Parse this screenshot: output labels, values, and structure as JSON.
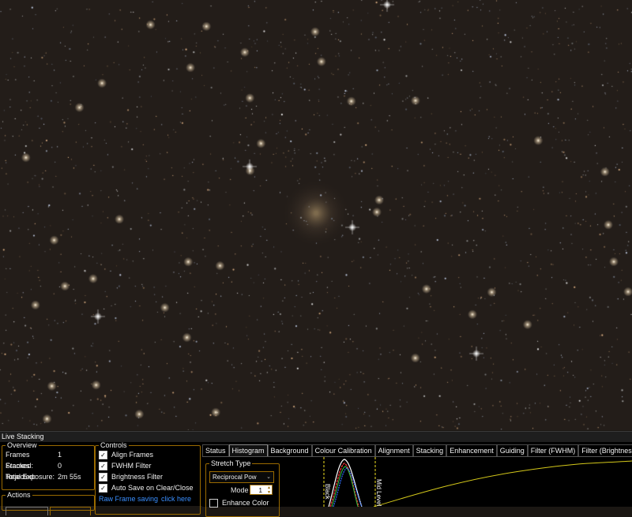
{
  "window": {
    "title": "Live Stacking"
  },
  "overview": {
    "legend": "Overview",
    "rows": [
      {
        "label": "Frames Stacked:",
        "value": "1"
      },
      {
        "label": "Frames Rejected:",
        "value": "0"
      },
      {
        "label": "Total Exposure:",
        "value": "2m 55s"
      }
    ]
  },
  "actions": {
    "legend": "Actions"
  },
  "controls": {
    "legend": "Controls",
    "items": [
      {
        "label": "Align Frames",
        "checked": true
      },
      {
        "label": "FWHM Filter",
        "checked": true
      },
      {
        "label": "Brightness Filter",
        "checked": true
      },
      {
        "label": "Auto Save on Clear/Close",
        "checked": true
      }
    ],
    "raw_frame_label": "Raw Frame saving",
    "raw_frame_link": "click here"
  },
  "tabs": [
    "Status",
    "Histogram",
    "Background",
    "Colour Calibration",
    "Alignment",
    "Stacking",
    "Enhancement",
    "Guiding",
    "Filter (FWHM)",
    "Filter (Brightness)"
  ],
  "active_tab": "Histogram",
  "histogram": {
    "stretch_legend": "Stretch Type",
    "stretch_value": "Reciprocal Pow",
    "mode_label": "Mode",
    "mode_value": "1",
    "enhance_color_label": "Enhance Color",
    "enhance_color_checked": false,
    "black_marker_label": "Black",
    "mid_marker_label": "Mid Level"
  },
  "colors": {
    "accent_border": "#9a6a00",
    "curve_yellow": "#d4c81a",
    "hist_red": "#e03030",
    "hist_green": "#30c040",
    "hist_blue": "#3070ff",
    "marker_yellow": "#f0e020"
  },
  "icons": {
    "chevron": "chevron-down-icon",
    "spin": "spin-arrows-icon",
    "check": "check-icon"
  }
}
